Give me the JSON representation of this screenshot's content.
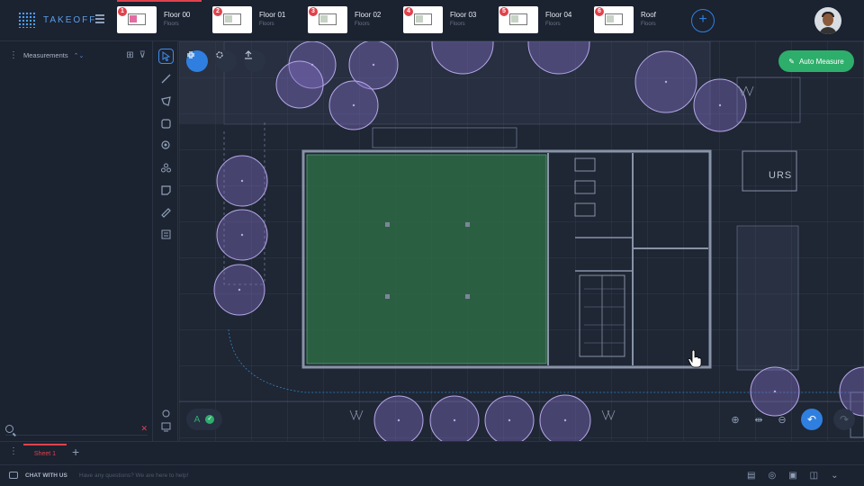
{
  "app": {
    "logo_text": "TAKEOFF"
  },
  "floors": [
    {
      "num": "1",
      "name": "Floor 00",
      "sub": "Floors",
      "active": true
    },
    {
      "num": "2",
      "name": "Floor 01",
      "sub": "Floors"
    },
    {
      "num": "3",
      "name": "Floor 02",
      "sub": "Floors"
    },
    {
      "num": "4",
      "name": "Floor 03",
      "sub": "Floors"
    },
    {
      "num": "5",
      "name": "Floor 04",
      "sub": "Floors"
    },
    {
      "num": "6",
      "name": "Roof",
      "sub": "Floors"
    }
  ],
  "left_panel": {
    "title": "Measurements",
    "search_placeholder": ""
  },
  "canvas": {
    "auto_measure_label": "Auto Measure",
    "plan_label": "URS",
    "layer_letter": "A"
  },
  "sheets": [
    {
      "label": "Sheet 1"
    }
  ],
  "footer": {
    "chat_label": "CHAT WITH US",
    "chat_hint": "Have any questions? We are here to help!"
  },
  "colors": {
    "accent": "#2f7fe0",
    "danger": "#e0424c",
    "success": "#2dae6b",
    "measured_area": "#2e6a45"
  }
}
